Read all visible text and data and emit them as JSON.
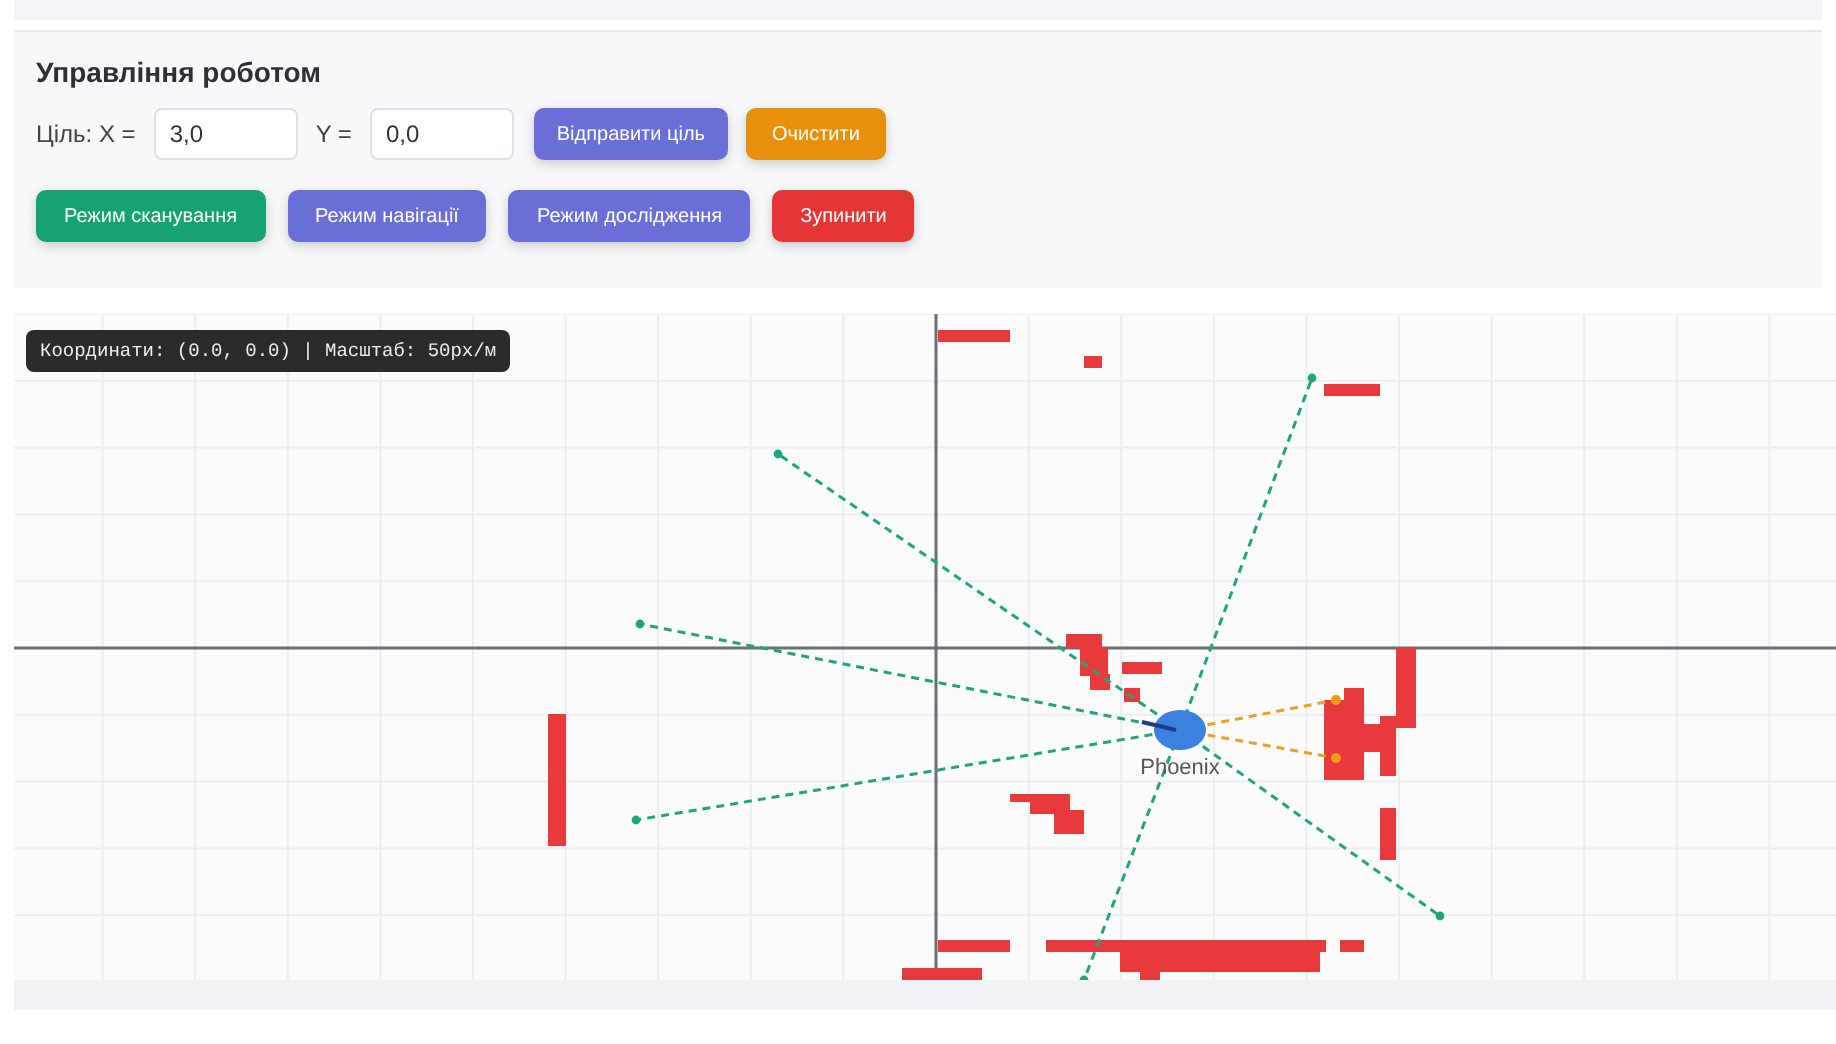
{
  "control_panel": {
    "title": "Управління роботом",
    "target": {
      "label": "Ціль: X =",
      "x_value": "3,0",
      "y_label": "Y =",
      "y_value": "0,0"
    },
    "target_buttons": [
      {
        "label": "Відправити ціль",
        "color": "#6a6fd8"
      },
      {
        "label": "Очистити",
        "color": "#e8900c"
      }
    ],
    "mode_buttons": [
      {
        "label": "Режим сканування",
        "color": "#16a372"
      },
      {
        "label": "Режим навігації",
        "color": "#6a6fd8"
      },
      {
        "label": "Режим дослідження",
        "color": "#6a6fd8"
      },
      {
        "label": "Зупинити",
        "color": "#e53535"
      }
    ]
  },
  "map": {
    "status": "Координати: (0.0, 0.0) | Масштаб: 50px/м",
    "robot_name": "Phoenix"
  }
}
